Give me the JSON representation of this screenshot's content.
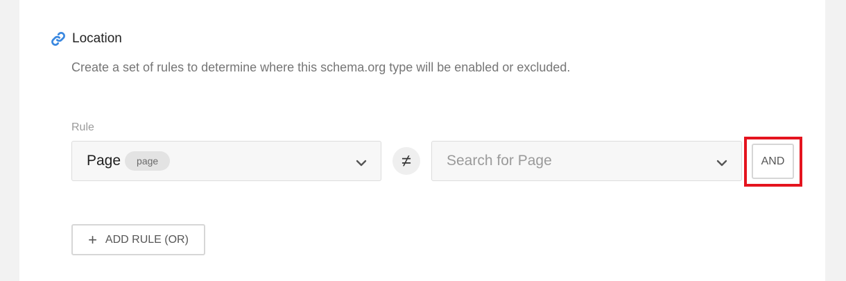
{
  "location_section": {
    "title": "Location",
    "description": "Create a set of rules to determine where this schema.org type will be enabled or excluded.",
    "icon": "link-icon",
    "icon_color": "#3a88e0"
  },
  "rule": {
    "label": "Rule",
    "left_select": {
      "value": "Page",
      "badge": "page"
    },
    "operator_symbol": "≠",
    "right_select": {
      "placeholder": "Search for Page"
    },
    "and_button_label": "AND",
    "highlight_color": "#e4141e"
  },
  "add_rule_button": {
    "label": "ADD RULE (OR)",
    "icon": "plus-icon"
  }
}
